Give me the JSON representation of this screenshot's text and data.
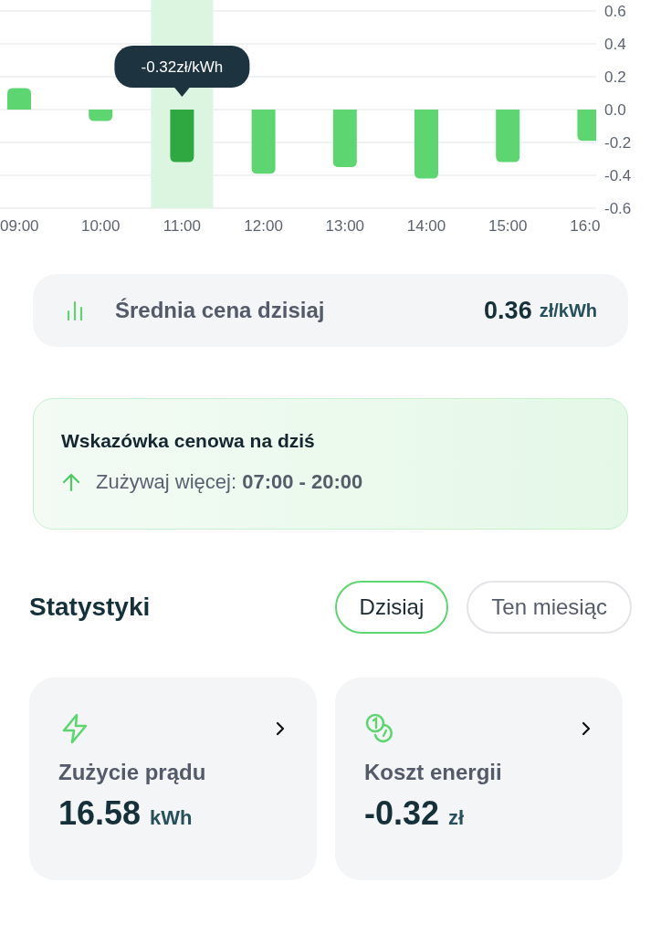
{
  "price_chart": {
    "chart_data": {
      "type": "bar",
      "categories": [
        "09:00",
        "10:00",
        "11:00",
        "12:00",
        "13:00",
        "14:00",
        "15:00",
        "16:0"
      ],
      "values": [
        0.13,
        -0.07,
        -0.32,
        -0.39,
        -0.35,
        -0.42,
        -0.32,
        -0.19
      ],
      "ylim": [
        -0.6,
        0.6
      ],
      "grid": true,
      "yticks": [
        {
          "value": 0.6,
          "label": "0.6"
        },
        {
          "value": 0.4,
          "label": "0.4"
        },
        {
          "value": 0.2,
          "label": "0.2"
        },
        {
          "value": 0,
          "label": "0.0"
        },
        {
          "value": -0.2,
          "label": "-0.2"
        },
        {
          "value": -0.4,
          "label": "-0.4"
        },
        {
          "value": -0.6,
          "label": "-0.6"
        }
      ]
    },
    "bars": [
      {
        "selected": false
      },
      {
        "selected": false
      },
      {
        "selected": true
      },
      {
        "selected": false
      },
      {
        "selected": false
      },
      {
        "selected": false
      },
      {
        "selected": false
      },
      {
        "selected": false
      }
    ],
    "tooltip": "-0.32zł/kWh"
  },
  "average_price": {
    "label": "Średnia cena dzisiaj",
    "value": "0.36",
    "unit": "zł/kWh"
  },
  "price_tip": {
    "title": "Wskazówka cenowa na dziś",
    "text": "Zużywaj więcej: **07:00 - 20:00**"
  },
  "statistics": {
    "title": "Statystyki",
    "tabs": [
      {
        "label": "Dzisiaj",
        "selected": true
      },
      {
        "label": "Ten miesiąc",
        "selected": false
      }
    ],
    "cards": [
      {
        "kind": "energy",
        "label": "Zużycie prądu",
        "value": "16.58",
        "unit": "kWh"
      },
      {
        "kind": "cost",
        "label": "Koszt energii",
        "value": "-0.32",
        "unit": "zł"
      }
    ]
  }
}
